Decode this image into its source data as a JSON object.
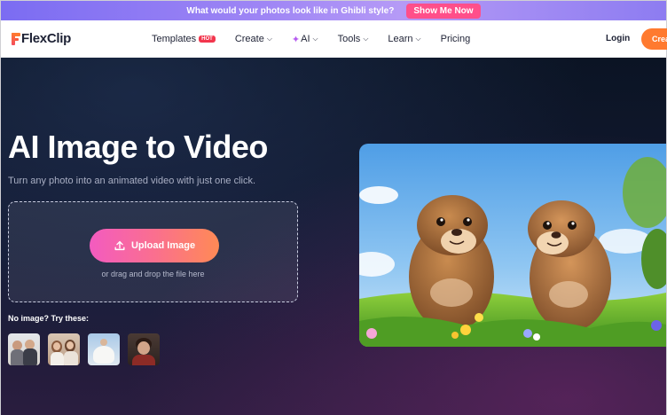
{
  "promo": {
    "text": "What would your photos look like in Ghibli style?",
    "button": "Show Me Now"
  },
  "nav": {
    "logo": "FlexClip",
    "items": [
      {
        "label": "Templates",
        "badge": "HOT",
        "dropdown": false
      },
      {
        "label": "Create",
        "dropdown": true
      },
      {
        "label": "AI",
        "dropdown": true,
        "icon": "sparkle-icon"
      },
      {
        "label": "Tools",
        "dropdown": true
      },
      {
        "label": "Learn",
        "dropdown": true
      },
      {
        "label": "Pricing",
        "dropdown": false
      }
    ],
    "login": "Login",
    "create_button": "Create"
  },
  "hero": {
    "title": "AI Image to Video",
    "subtitle": "Turn any photo into an animated video with just one click.",
    "upload_button": "Upload Image",
    "drop_hint": "or drag and drop the file here",
    "try_label": "No image? Try these:"
  },
  "colors": {
    "brand_orange": "#ff7a2f",
    "promo_button": "#ff4f8a",
    "hero_bg": "#0b1424",
    "upload_gradient_start": "#f35bc0",
    "upload_gradient_end": "#ff8a55"
  }
}
